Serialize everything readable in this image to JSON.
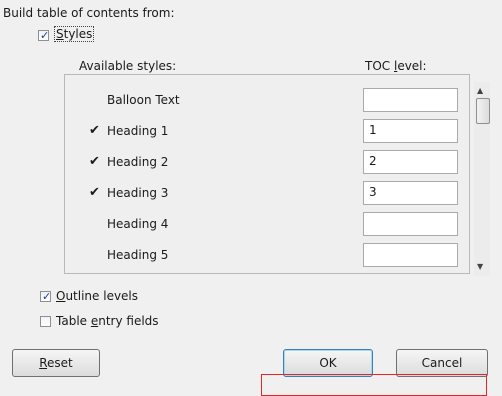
{
  "dialog": {
    "build_from_label": "Build table of contents from:",
    "styles_option": {
      "label_prefix": "",
      "accel": "S",
      "label_rest": "tyles",
      "checked": true
    },
    "columns": {
      "available": "Available styles:",
      "toc_prefix": "TOC ",
      "toc_accel": "l",
      "toc_rest": "evel:"
    },
    "rows": [
      {
        "name": "Balloon Text",
        "checked": false,
        "level": ""
      },
      {
        "name": "Heading 1",
        "checked": true,
        "level": "1"
      },
      {
        "name": "Heading 2",
        "checked": true,
        "level": "2"
      },
      {
        "name": "Heading 3",
        "checked": true,
        "level": "3"
      },
      {
        "name": "Heading 4",
        "checked": false,
        "level": ""
      },
      {
        "name": "Heading 5",
        "checked": false,
        "level": ""
      }
    ],
    "checkmark_glyph": "✔",
    "outline_levels": {
      "accel": "O",
      "rest": "utline levels",
      "checked": true
    },
    "table_entry": {
      "prefix": "Table ",
      "accel": "e",
      "rest": "ntry fields",
      "checked": false
    },
    "buttons": {
      "reset_accel": "R",
      "reset_rest": "eset",
      "ok": "OK",
      "cancel": "Cancel"
    },
    "scrollbar": {
      "up_glyph": "▲",
      "down_glyph": "▼"
    },
    "highlight_color": "#e3262a"
  }
}
